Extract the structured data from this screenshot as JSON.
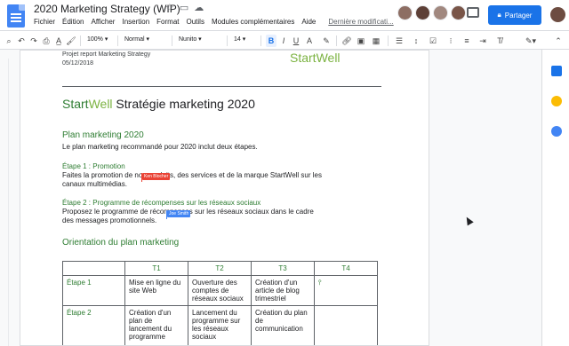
{
  "doc": {
    "title": "2020 Marketing Strategy (WIP)",
    "menu": [
      "Fichier",
      "Édition",
      "Afficher",
      "Insertion",
      "Format",
      "Outils",
      "Modules complémentaires",
      "Aide"
    ],
    "last_edit": "Dernière modificati..."
  },
  "share": {
    "label": "Partager"
  },
  "toolbar": {
    "zoom": "100%",
    "style": "Normal",
    "font": "Nunito",
    "size": "14"
  },
  "page": {
    "header_partial": "Projet report Marketing Strategy",
    "date": "05/12/2018",
    "logo_partial": "StartWell",
    "doc_title_start": "Start",
    "doc_title_well": "Well",
    "doc_title_rest": " Stratégie marketing 2020",
    "section1_title": "Plan marketing 2020",
    "section1_body": "Le plan marketing recommandé pour 2020 inclut deux étapes.",
    "step1_title": "Étape 1 : Promotion",
    "step1_line1": "Faites la promotion de nos produits, des services et de la marque StartWell sur les",
    "step1_line2": "canaux multimédias.",
    "step2_title": "Étape 2 : Programme de récompenses sur les réseaux sociaux",
    "step2_line1": "Proposez le programme de récompenses sur les réseaux sociaux dans le cadre",
    "step2_line2": "des messages promotionnels.",
    "section2_title": "Orientation du plan marketing",
    "collab1": "Ken Blocher",
    "collab2": "Joe Smith"
  },
  "table": {
    "headers": [
      "",
      "T1",
      "T2",
      "T3",
      "T4"
    ],
    "rows": [
      {
        "label": "Étape 1",
        "cells": [
          "Mise en ligne du site Web",
          "Ouverture des comptes de réseaux sociaux",
          "Création d'un article de blog trimestriel",
          ""
        ]
      },
      {
        "label": "Étape 2",
        "cells": [
          "Création d'un plan de lancement du programme",
          "Lancement du programme sur les réseaux sociaux",
          "Création du plan de communication",
          ""
        ]
      }
    ]
  },
  "colors": {
    "accent": "#1a73e8",
    "heading_green": "#2e7d32",
    "brand_green": "#7cb342",
    "collab1": "#ea4335",
    "collab2": "#4285f4"
  }
}
